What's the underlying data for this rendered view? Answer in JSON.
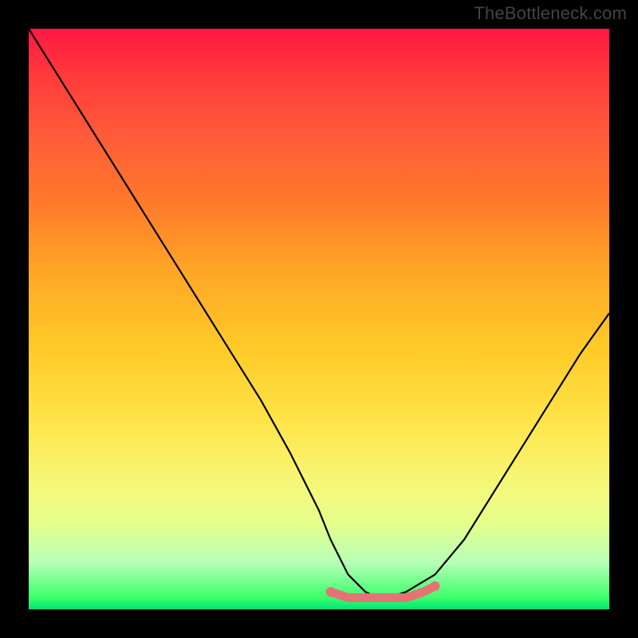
{
  "watermark": "TheBottleneck.com",
  "chart_data": {
    "type": "line",
    "title": "",
    "xlabel": "",
    "ylabel": "",
    "xlim": [
      0,
      100
    ],
    "ylim": [
      0,
      100
    ],
    "grid": false,
    "legend": false,
    "series": [
      {
        "name": "bottleneck-curve",
        "color": "#000000",
        "x": [
          0,
          5,
          10,
          15,
          20,
          25,
          30,
          35,
          40,
          45,
          50,
          52,
          55,
          58,
          60,
          62,
          65,
          70,
          75,
          80,
          85,
          90,
          95,
          100
        ],
        "y": [
          100,
          92,
          84,
          76,
          68,
          60,
          52,
          44,
          36,
          27,
          17,
          12,
          6,
          3,
          2,
          2,
          3,
          6,
          12,
          20,
          28,
          36,
          44,
          51
        ]
      },
      {
        "name": "highlight-band",
        "color": "#e57373",
        "x": [
          52,
          55,
          58,
          60,
          62,
          65,
          68,
          70
        ],
        "y": [
          3,
          2,
          2,
          2,
          2,
          2,
          3,
          4
        ]
      }
    ]
  }
}
